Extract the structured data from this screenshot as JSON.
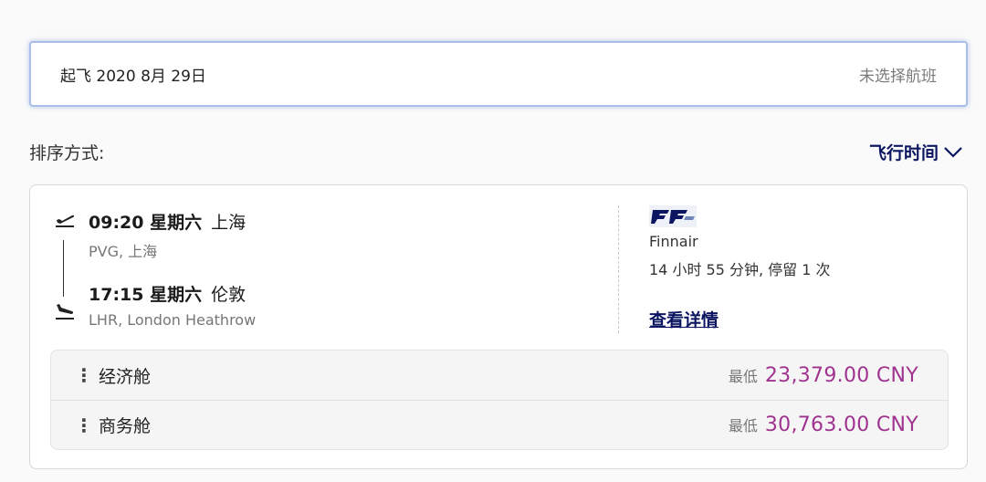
{
  "search": {
    "departure_label": "起飞 2020 8月 29日",
    "status": "未选择航班"
  },
  "sort": {
    "label": "排序方式:",
    "value": "飞行时间"
  },
  "flight": {
    "departure": {
      "time_day": "09:20 星期六",
      "city": "上海",
      "airport": "PVG, 上海"
    },
    "arrival": {
      "time_day": "17:15 星期六",
      "city": "伦敦",
      "airport": "LHR, London Heathrow"
    },
    "airline": "Finnair",
    "duration_stops": "14 小时 55 分钟, 停留 1 次",
    "details_link": "查看详情"
  },
  "fares": [
    {
      "cabin": "经济舱",
      "from_label": "最低",
      "price": "23,379.00 CNY"
    },
    {
      "cabin": "商务舱",
      "from_label": "最低",
      "price": "30,763.00 CNY"
    }
  ],
  "colors": {
    "accent_navy": "#0b1560",
    "price_purple": "#a0338f",
    "focus_border": "#a9bfe8"
  }
}
